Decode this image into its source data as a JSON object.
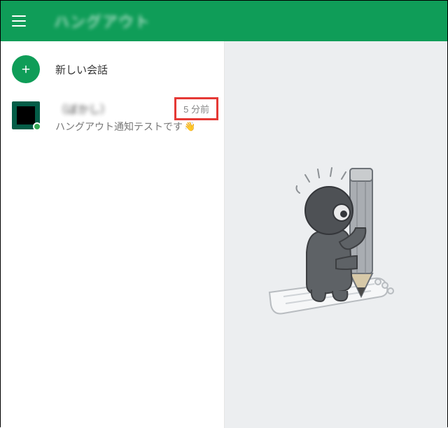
{
  "header": {
    "title": "ハングアウト"
  },
  "sidebar": {
    "new_conversation_label": "新しい会話",
    "conversations": [
      {
        "name": "（ぼかし）",
        "snippet": "ハングアウト通知テストです",
        "snippet_emoji": "👋",
        "time": "5 分前"
      }
    ]
  },
  "colors": {
    "accent": "#0f9d58",
    "annotation": "#e53935"
  }
}
